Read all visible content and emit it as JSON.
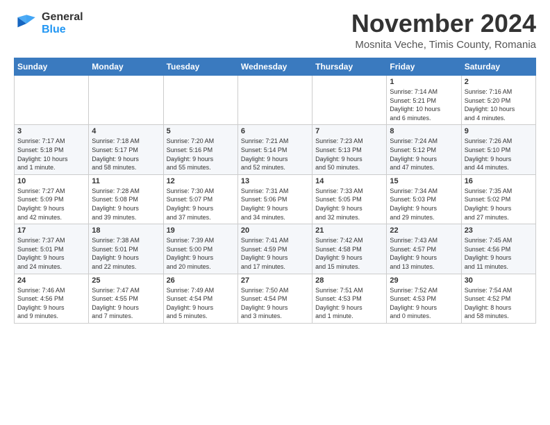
{
  "logo": {
    "line1": "General",
    "line2": "Blue"
  },
  "title": "November 2024",
  "subtitle": "Mosnita Veche, Timis County, Romania",
  "headers": [
    "Sunday",
    "Monday",
    "Tuesday",
    "Wednesday",
    "Thursday",
    "Friday",
    "Saturday"
  ],
  "weeks": [
    [
      {
        "day": "",
        "info": ""
      },
      {
        "day": "",
        "info": ""
      },
      {
        "day": "",
        "info": ""
      },
      {
        "day": "",
        "info": ""
      },
      {
        "day": "",
        "info": ""
      },
      {
        "day": "1",
        "info": "Sunrise: 7:14 AM\nSunset: 5:21 PM\nDaylight: 10 hours\nand 6 minutes."
      },
      {
        "day": "2",
        "info": "Sunrise: 7:16 AM\nSunset: 5:20 PM\nDaylight: 10 hours\nand 4 minutes."
      }
    ],
    [
      {
        "day": "3",
        "info": "Sunrise: 7:17 AM\nSunset: 5:18 PM\nDaylight: 10 hours\nand 1 minute."
      },
      {
        "day": "4",
        "info": "Sunrise: 7:18 AM\nSunset: 5:17 PM\nDaylight: 9 hours\nand 58 minutes."
      },
      {
        "day": "5",
        "info": "Sunrise: 7:20 AM\nSunset: 5:16 PM\nDaylight: 9 hours\nand 55 minutes."
      },
      {
        "day": "6",
        "info": "Sunrise: 7:21 AM\nSunset: 5:14 PM\nDaylight: 9 hours\nand 52 minutes."
      },
      {
        "day": "7",
        "info": "Sunrise: 7:23 AM\nSunset: 5:13 PM\nDaylight: 9 hours\nand 50 minutes."
      },
      {
        "day": "8",
        "info": "Sunrise: 7:24 AM\nSunset: 5:12 PM\nDaylight: 9 hours\nand 47 minutes."
      },
      {
        "day": "9",
        "info": "Sunrise: 7:26 AM\nSunset: 5:10 PM\nDaylight: 9 hours\nand 44 minutes."
      }
    ],
    [
      {
        "day": "10",
        "info": "Sunrise: 7:27 AM\nSunset: 5:09 PM\nDaylight: 9 hours\nand 42 minutes."
      },
      {
        "day": "11",
        "info": "Sunrise: 7:28 AM\nSunset: 5:08 PM\nDaylight: 9 hours\nand 39 minutes."
      },
      {
        "day": "12",
        "info": "Sunrise: 7:30 AM\nSunset: 5:07 PM\nDaylight: 9 hours\nand 37 minutes."
      },
      {
        "day": "13",
        "info": "Sunrise: 7:31 AM\nSunset: 5:06 PM\nDaylight: 9 hours\nand 34 minutes."
      },
      {
        "day": "14",
        "info": "Sunrise: 7:33 AM\nSunset: 5:05 PM\nDaylight: 9 hours\nand 32 minutes."
      },
      {
        "day": "15",
        "info": "Sunrise: 7:34 AM\nSunset: 5:03 PM\nDaylight: 9 hours\nand 29 minutes."
      },
      {
        "day": "16",
        "info": "Sunrise: 7:35 AM\nSunset: 5:02 PM\nDaylight: 9 hours\nand 27 minutes."
      }
    ],
    [
      {
        "day": "17",
        "info": "Sunrise: 7:37 AM\nSunset: 5:01 PM\nDaylight: 9 hours\nand 24 minutes."
      },
      {
        "day": "18",
        "info": "Sunrise: 7:38 AM\nSunset: 5:01 PM\nDaylight: 9 hours\nand 22 minutes."
      },
      {
        "day": "19",
        "info": "Sunrise: 7:39 AM\nSunset: 5:00 PM\nDaylight: 9 hours\nand 20 minutes."
      },
      {
        "day": "20",
        "info": "Sunrise: 7:41 AM\nSunset: 4:59 PM\nDaylight: 9 hours\nand 17 minutes."
      },
      {
        "day": "21",
        "info": "Sunrise: 7:42 AM\nSunset: 4:58 PM\nDaylight: 9 hours\nand 15 minutes."
      },
      {
        "day": "22",
        "info": "Sunrise: 7:43 AM\nSunset: 4:57 PM\nDaylight: 9 hours\nand 13 minutes."
      },
      {
        "day": "23",
        "info": "Sunrise: 7:45 AM\nSunset: 4:56 PM\nDaylight: 9 hours\nand 11 minutes."
      }
    ],
    [
      {
        "day": "24",
        "info": "Sunrise: 7:46 AM\nSunset: 4:56 PM\nDaylight: 9 hours\nand 9 minutes."
      },
      {
        "day": "25",
        "info": "Sunrise: 7:47 AM\nSunset: 4:55 PM\nDaylight: 9 hours\nand 7 minutes."
      },
      {
        "day": "26",
        "info": "Sunrise: 7:49 AM\nSunset: 4:54 PM\nDaylight: 9 hours\nand 5 minutes."
      },
      {
        "day": "27",
        "info": "Sunrise: 7:50 AM\nSunset: 4:54 PM\nDaylight: 9 hours\nand 3 minutes."
      },
      {
        "day": "28",
        "info": "Sunrise: 7:51 AM\nSunset: 4:53 PM\nDaylight: 9 hours\nand 1 minute."
      },
      {
        "day": "29",
        "info": "Sunrise: 7:52 AM\nSunset: 4:53 PM\nDaylight: 9 hours\nand 0 minutes."
      },
      {
        "day": "30",
        "info": "Sunrise: 7:54 AM\nSunset: 4:52 PM\nDaylight: 8 hours\nand 58 minutes."
      }
    ]
  ]
}
